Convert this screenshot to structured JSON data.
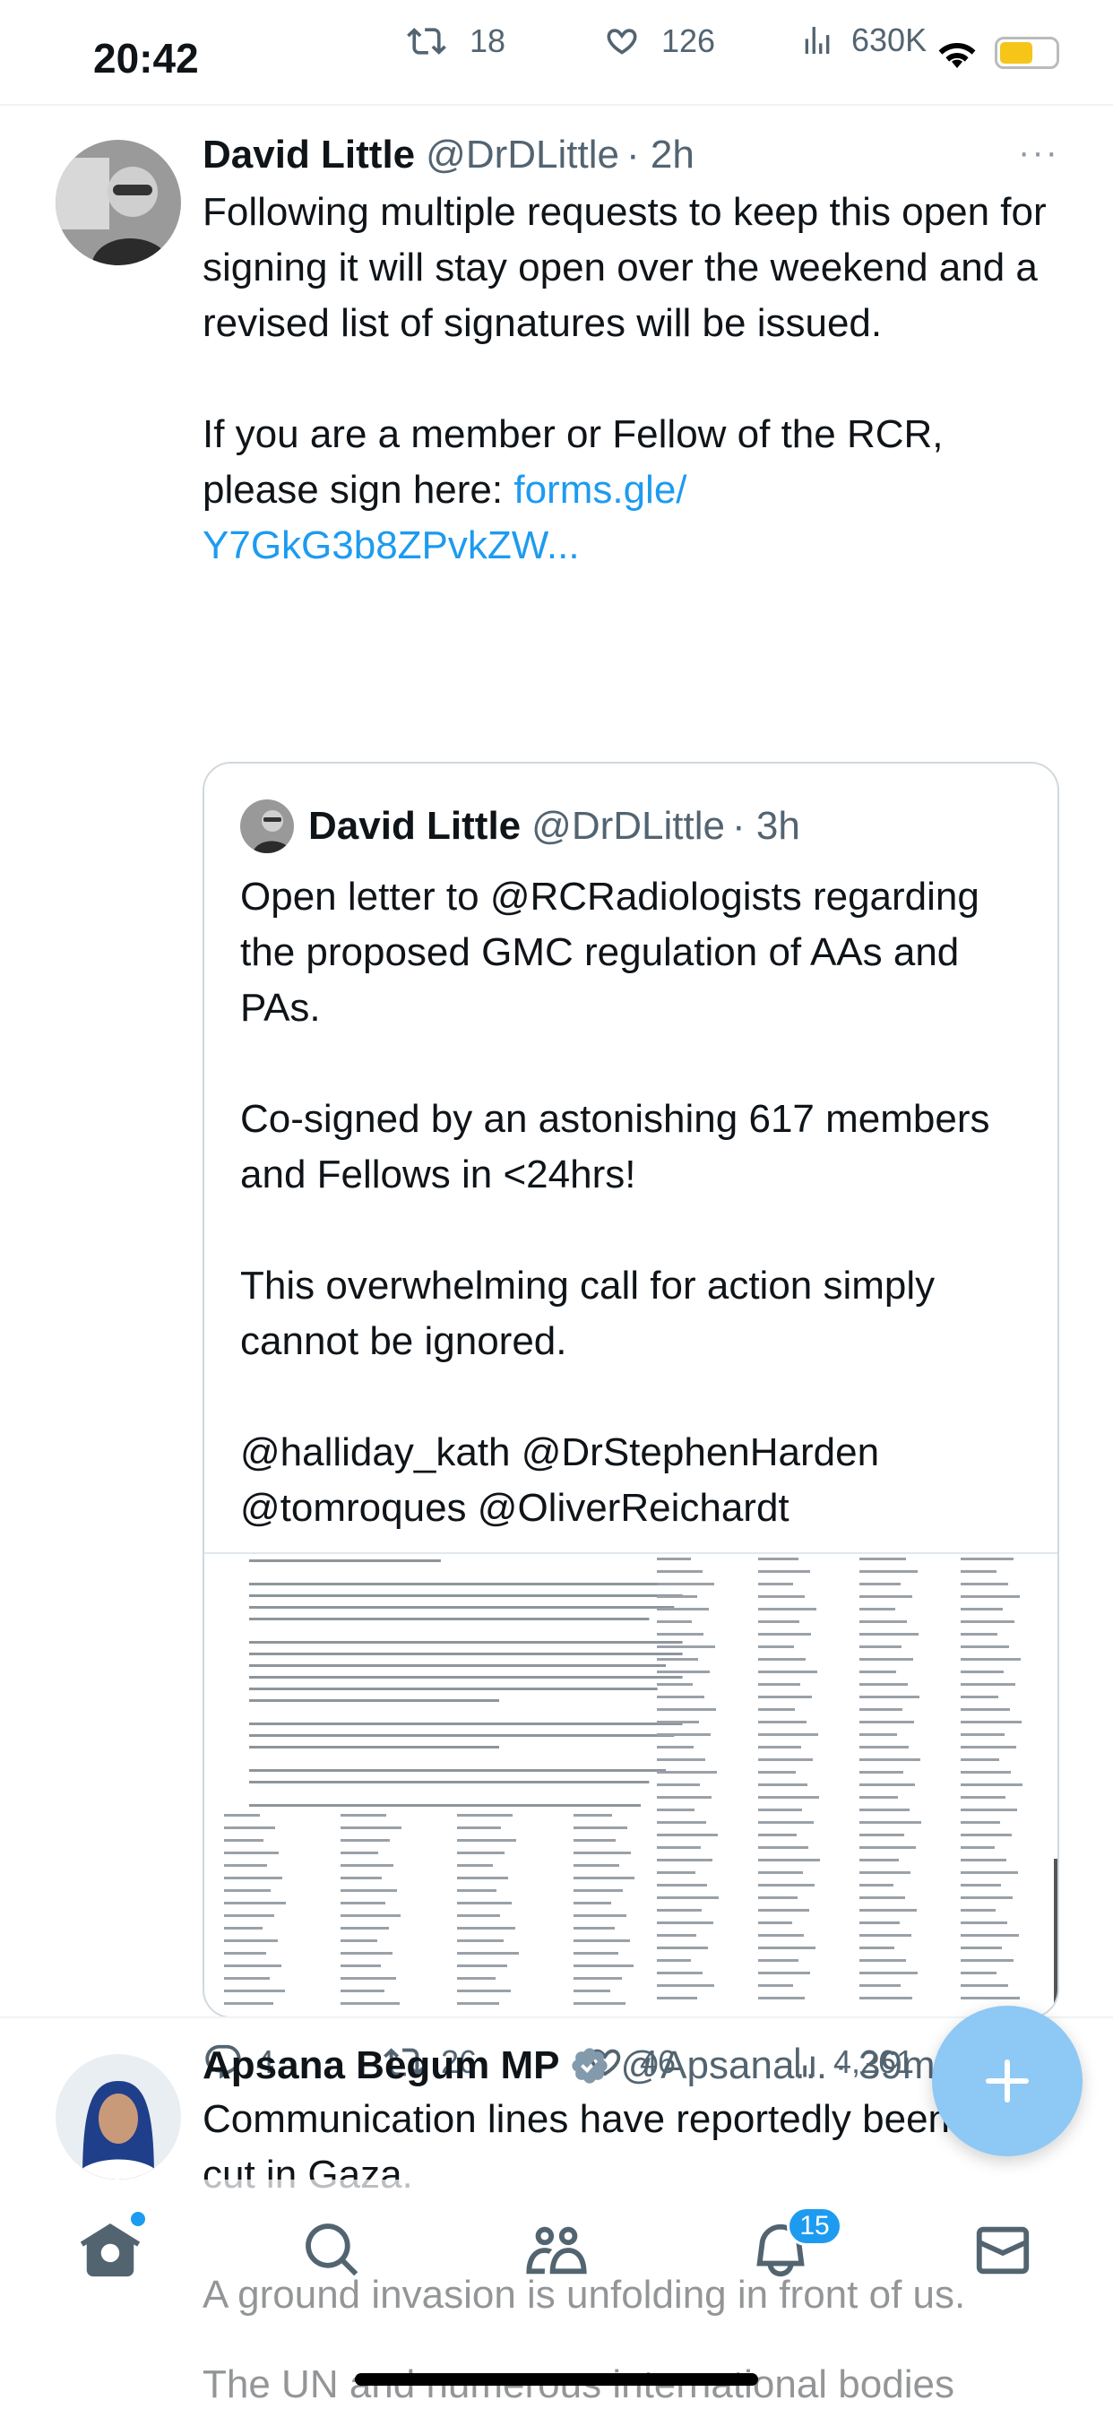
{
  "status_bar": {
    "time": "20:42",
    "overlay_retweets": "18",
    "overlay_likes": "126",
    "overlay_views": "630K"
  },
  "tweet1": {
    "name": "David Little",
    "handle": "@DrDLittle",
    "time": "· 2h",
    "more": "···",
    "text_main": "Following multiple requests to keep this open for signing it will stay open over the weekend and a revised list of signatures will be issued.\n\nIf you are a member or Fellow of the RCR, please sign here: ",
    "link_text": "forms.gle/\nY7GkG3b8ZPvkZW...",
    "quote": {
      "name": "David Little",
      "handle": "@DrDLittle",
      "time": "· 3h",
      "text": "Open letter to @RCRadiologists regarding the proposed GMC regulation of AAs and PAs.\n\nCo-signed by an astonishing 617 members and Fellows in <24hrs!\n\nThis overwhelming call for action simply cannot be ignored.\n\n@halliday_kath @DrStephenHarden @tomroques @OliverReichardt"
    },
    "actions": {
      "replies": "4",
      "retweets": "26",
      "likes": "46",
      "views": "4,261"
    }
  },
  "tweet2": {
    "name": "Apsana Begum MP",
    "handle": "@Apsana...",
    "time": "· 39m",
    "text_line1": "Communication lines have reportedly been",
    "text_line2": "cut in Gaza.",
    "text_line3": "A ground invasion is unfolding in front of us.",
    "text_line4": "The UN and numerous international bodies"
  },
  "tab_bar": {
    "notification_count": "15"
  },
  "colors": {
    "accent": "#1d9bf0",
    "text": "#0f1419",
    "muted": "#536471"
  }
}
